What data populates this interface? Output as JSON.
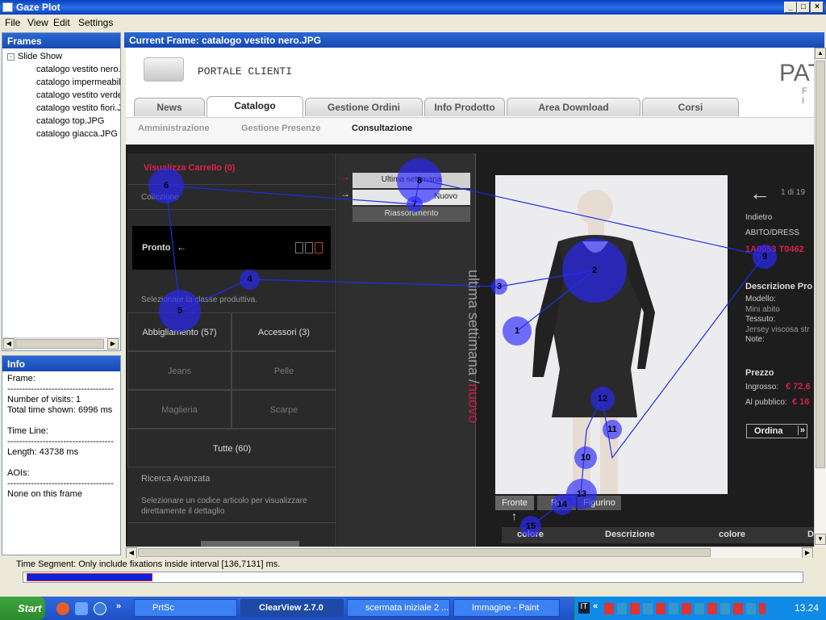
{
  "window": {
    "title": "Gaze Plot"
  },
  "menu": [
    "File",
    "View",
    "Edit",
    "Settings"
  ],
  "frames_panel": {
    "title": "Frames",
    "root": "Slide Show",
    "items": [
      "catalogo vestito nero.",
      "catalogo impermeabile",
      "catalogo vestito verde",
      "catalogo vestito fiori.J",
      "catalogo top.JPG",
      "catalogo giacca.JPG"
    ]
  },
  "info_panel": {
    "title": "Info",
    "frame_label": "Frame:",
    "divider": "------------------------------------",
    "visits": "Number of visits: 1",
    "total_time": "Total time shown: 6996 ms",
    "timeline_label": "Time Line:",
    "length": "Length: 43738 ms",
    "aois_label": "AOIs:",
    "aois_value": "None on this frame"
  },
  "current_frame": "Current Frame:  catalogo vestito nero.JPG",
  "site": {
    "portal": "PORTALE CLIENTI",
    "brand": "PAT",
    "brand_sub": "F I",
    "tabs": [
      "News",
      "Catalogo",
      "Gestione Ordini",
      "Info Prodotto",
      "Area Download",
      "Corsi"
    ],
    "subnav": [
      "Amministrazione",
      "Gestione Presenze",
      "Consultazione"
    ],
    "cart": "Visualizza Carrello (0)",
    "collection": "Collezione",
    "ready": "Pronto",
    "select_class": "Selezionare la classe produttiva.",
    "categories": [
      "Abbigliamento (57)",
      "Accessori (3)",
      "Jeans",
      "Pelle",
      "Maglieria",
      "Scarpe"
    ],
    "all": "Tutte (60)",
    "advanced_search": "Ricerca Avanzata",
    "advanced_hint": "Selezionare un codice articolo per visualizzare direttamente il dettaglio",
    "filters": [
      "Ultima settimana",
      "Nuovo",
      "Riassortimento"
    ],
    "vertical_text_1": "ultima settimana /",
    "vertical_text_2": "nuovo",
    "pager": "1 di 19",
    "back": "Indietro",
    "product_type": "ABITO/DRESS",
    "product_code": "1A0053 T0462",
    "desc_title": "Descrizione Pro",
    "model_label": "Modello:",
    "model_value": "Mini abito",
    "fabric_label": "Tessuto:",
    "fabric_value": "Jersey viscosa str",
    "notes_label": "Note:",
    "price_title": "Prezzo",
    "wholesale_label": "Ingrosso:",
    "wholesale_value": "€ 72,6",
    "retail_label": "Al pubblico:",
    "retail_value": "€ 16",
    "order": "Ordina",
    "views": [
      "Fronte",
      "Re",
      "Figurino"
    ],
    "col_headers": [
      "colore",
      "Descrizione",
      "colore",
      "D"
    ]
  },
  "fixations": [
    "1",
    "2",
    "3",
    "4",
    "5",
    "6",
    "7",
    "8",
    "9",
    "10",
    "11",
    "12",
    "13",
    "14",
    "15"
  ],
  "time_segment": "Time Segment: Only include fixations inside interval [136,7131] ms.",
  "taskbar": {
    "start": "Start",
    "tasks": [
      "PrtSc",
      "ClearView 2.7.0",
      "scermata iniziale 2 ...",
      "Immagine - Paint"
    ],
    "clock": "13.24"
  }
}
